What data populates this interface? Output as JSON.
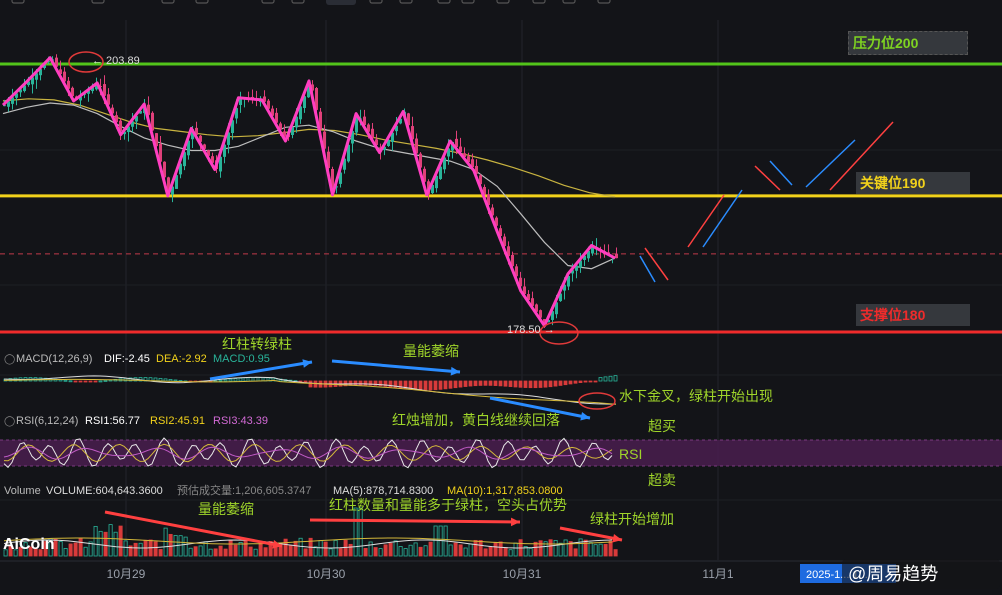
{
  "toolbar": {
    "icons": [
      "chart-type-icon",
      "indicator-icon",
      "draw-icon",
      "settings-icon",
      "layout-icon",
      "compare-icon",
      "alert-icon",
      "snapshot-icon",
      "fullscreen-icon"
    ]
  },
  "chart_data": {
    "type": "candlestick",
    "levels": [
      {
        "name": "resistance",
        "label": "压力位200",
        "value": 203.3,
        "color": "#52c41a"
      },
      {
        "name": "key",
        "label": "关键位190",
        "value": 190.8,
        "color": "#f2d21b"
      },
      {
        "name": "support",
        "label": "支撑位180",
        "value": 177.9,
        "color": "#ef2b2b"
      }
    ],
    "last_price_line": 185.3,
    "high_label": "203.89",
    "low_label": "178.50",
    "x_ticks": [
      "10月29",
      "10月30",
      "10月31",
      "11月1"
    ],
    "date_badge": "2025-1... 1...",
    "price_path": [
      199.4,
      201.6,
      203.9,
      199.8,
      201.5,
      196.6,
      199.5,
      190.8,
      197.2,
      193.3,
      200.1,
      199.9,
      196.0,
      201.7,
      190.9,
      198.6,
      194.9,
      198.8,
      190.9,
      196.0,
      193.2,
      187.4,
      181.8,
      178.5,
      183.4,
      186.1,
      184.9
    ],
    "ma_white": [
      198.6,
      199.2,
      199.6,
      199.4,
      198.6,
      197.4,
      196.3,
      195.6,
      195.1,
      195.1,
      195.5,
      196.4,
      197.3,
      197.5,
      196.9,
      196.0,
      195.3,
      194.9,
      194.5,
      194.1,
      193.3,
      191.7,
      189.1,
      186.4,
      184.2,
      183.9,
      184.9
    ],
    "ma_yellow": [
      199.8,
      200.0,
      199.9,
      199.4,
      198.6,
      197.8,
      197.2,
      196.9,
      196.6,
      196.4,
      196.5,
      196.8,
      197.1,
      197.0,
      196.6,
      196.1,
      195.7,
      195.3,
      194.8,
      194.2,
      193.5,
      192.7,
      191.8,
      191.1,
      190.7
    ],
    "macd": {
      "label": "MACD(12,26,9)",
      "dif": "DIF:-2.45",
      "dea": "DEA:-2.92",
      "macd": "MACD:0.95"
    },
    "rsi": {
      "label": "RSI(6,12,24)",
      "rsi1": "RSI1:56.77",
      "rsi2": "RSI2:45.91",
      "rsi3": "RSI3:43.39"
    },
    "volume": {
      "label": "Volume",
      "value": "VOLUME:604,643.3600",
      "forecast": "预估成交量:1,206,605.3747",
      "ma5": "MA(5):878,714.8300",
      "ma10": "MA(10):1,317,853.0800"
    },
    "annotations": [
      {
        "name": "macd-red-to-green",
        "text": "红柱转绿柱"
      },
      {
        "name": "volume-shrinking-top",
        "text": "量能萎缩"
      },
      {
        "name": "golden-cross-underwater",
        "text": "水下金叉，绿柱开始出现"
      },
      {
        "name": "red-candles-increase",
        "text": "红烛增加，黄白线继续回落"
      },
      {
        "name": "overbought",
        "text": "超买"
      },
      {
        "name": "rsi-band",
        "text": "RSI"
      },
      {
        "name": "oversold",
        "text": "超卖"
      },
      {
        "name": "volume-shrinking-bottom",
        "text": "量能萎缩"
      },
      {
        "name": "red-bars-dominate",
        "text": "红柱数量和量能多于绿柱，空头占优势"
      },
      {
        "name": "green-bars-increase",
        "text": "绿柱开始增加"
      }
    ],
    "logo": "AiCoin",
    "watermark": "@周易趋势"
  },
  "colors": {
    "bg": "#131418",
    "up": "#29b49a",
    "down": "#e0407a",
    "pink": "#ff3ec0",
    "yellow": "#f2d21b",
    "green": "#52c41a",
    "red": "#ef2b2b",
    "annot_green": "#9fd52a",
    "arrow_blue": "#2a8cff",
    "arrow_red": "#ff4040"
  }
}
